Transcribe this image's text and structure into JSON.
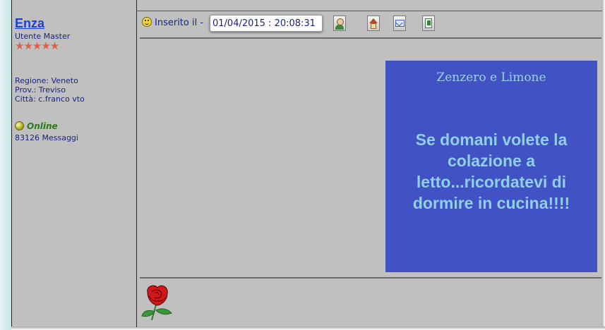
{
  "author": {
    "name": "Enza",
    "rank": "Utente Master",
    "stars": "★★★★★",
    "region": "Regione: Veneto",
    "province": "Prov.: Treviso",
    "city": "Città: c.franco vto",
    "status": "Online",
    "messages": "83126 Messaggi"
  },
  "post": {
    "inserted_label": "Inserito il -",
    "timestamp": "01/04/2015 : 20:08:31",
    "toolbar": {
      "profile": "profile-icon",
      "home": "home-icon",
      "email": "email-icon",
      "quote": "quote-icon"
    }
  },
  "card": {
    "title": "Zenzero e Limone",
    "text": "Se domani volete la colazione a letto...ricordatevi di dormire in cucina!!!!",
    "background": "#4152c4",
    "text_color": "#8fd0e6"
  },
  "signature": {
    "image": "rose-icon"
  }
}
